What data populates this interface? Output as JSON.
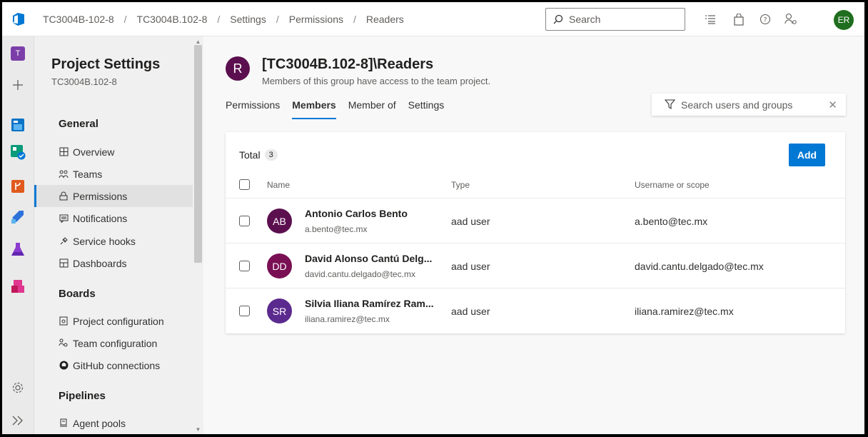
{
  "breadcrumb": [
    "TC3004B-102-8",
    "TC3004B.102-8",
    "Settings",
    "Permissions",
    "Readers"
  ],
  "search": {
    "placeholder": "Search"
  },
  "user": {
    "initials": "ER"
  },
  "rail": {
    "project_initial": "T"
  },
  "sidebar": {
    "title": "Project Settings",
    "subtitle": "TC3004B.102-8",
    "sections": {
      "general": "General",
      "boards": "Boards",
      "pipelines": "Pipelines"
    },
    "general_items": [
      "Overview",
      "Teams",
      "Permissions",
      "Notifications",
      "Service hooks",
      "Dashboards"
    ],
    "boards_items": [
      "Project configuration",
      "Team configuration",
      "GitHub connections"
    ],
    "pipelines_items": [
      "Agent pools"
    ]
  },
  "group": {
    "initial": "R",
    "title": "[TC3004B.102-8]\\Readers",
    "description": "Members of this group have access to the team project."
  },
  "tabs": [
    "Permissions",
    "Members",
    "Member of",
    "Settings"
  ],
  "filter": {
    "placeholder": "Search users and groups"
  },
  "members": {
    "total_label": "Total",
    "total_count": "3",
    "add_label": "Add",
    "columns": [
      "Name",
      "Type",
      "Username or scope"
    ],
    "rows": [
      {
        "initials": "AB",
        "name": "Antonio Carlos Bento",
        "email": "a.bento@tec.mx",
        "type": "aad user",
        "scope": "a.bento@tec.mx",
        "color": "#5c0f4f"
      },
      {
        "initials": "DD",
        "name": "David Alonso Cantú Delg...",
        "email": "david.cantu.delgado@tec.mx",
        "type": "aad user",
        "scope": "david.cantu.delgado@tec.mx",
        "color": "#7a1054"
      },
      {
        "initials": "SR",
        "name": "Silvia Iliana Ramírez Ram...",
        "email": "iliana.ramirez@tec.mx",
        "type": "aad user",
        "scope": "iliana.ramirez@tec.mx",
        "color": "#5b2a8e"
      }
    ]
  },
  "colors": {
    "accent": "#0078d4"
  }
}
